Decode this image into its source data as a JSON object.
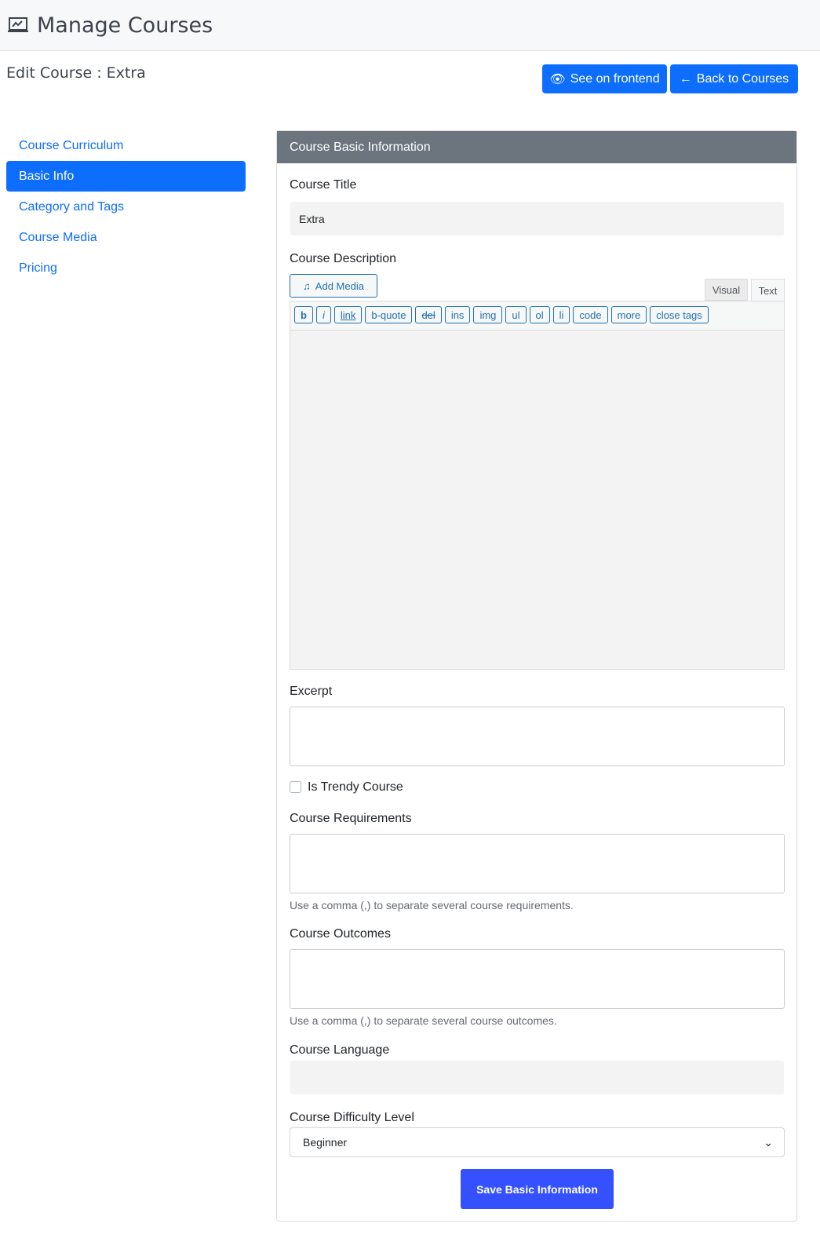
{
  "header": {
    "title": "Manage Courses",
    "icon": "presentation-chart-icon"
  },
  "page": {
    "subtitle": "Edit Course : Extra"
  },
  "actions": {
    "frontend": "See on frontend",
    "back": "Back to Courses"
  },
  "sidebar": {
    "items": [
      {
        "label": "Course Curriculum"
      },
      {
        "label": "Basic Info",
        "active": true
      },
      {
        "label": "Category and Tags"
      },
      {
        "label": "Course Media"
      },
      {
        "label": "Pricing"
      }
    ]
  },
  "form": {
    "card_title": "Course Basic Information",
    "title_label": "Course Title",
    "title_value": "Extra",
    "desc_label": "Course Description",
    "add_media": "Add Media",
    "tab_visual": "Visual",
    "tab_text": "Text",
    "quicktags": [
      "b",
      "i",
      "link",
      "b-quote",
      "del",
      "ins",
      "img",
      "ul",
      "ol",
      "li",
      "code",
      "more",
      "close tags"
    ],
    "excerpt_label": "Excerpt",
    "trendy_label": "Is Trendy Course",
    "trendy_checked": false,
    "req_label": "Course Requirements",
    "req_help": "Use a comma (,) to separate several course requirements.",
    "out_label": "Course Outcomes",
    "out_help": "Use a comma (,) to separate several course outcomes.",
    "lang_label": "Course Language",
    "lang_value": "",
    "diff_label": "Course Difficulty Level",
    "diff_value": "Beginner",
    "save": "Save Basic Information"
  },
  "colors": {
    "primary": "#0d6efd",
    "save": "#3450ff",
    "card_header": "#6c757d",
    "wp_blue": "#2271b1"
  }
}
